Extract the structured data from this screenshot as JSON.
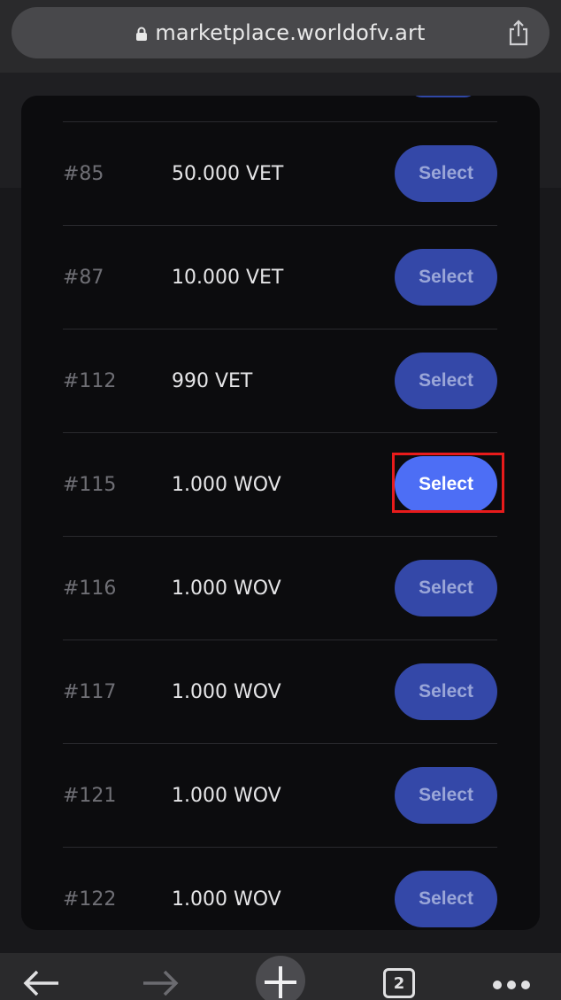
{
  "browser": {
    "url": "marketplace.worldofv.art",
    "tab_count": "2"
  },
  "listings": [
    {
      "number": "#85",
      "price": "50.000 VET",
      "button_label": "Select",
      "active": false
    },
    {
      "number": "#87",
      "price": "10.000 VET",
      "button_label": "Select",
      "active": false
    },
    {
      "number": "#112",
      "price": "990 VET",
      "button_label": "Select",
      "active": false
    },
    {
      "number": "#115",
      "price": "1.000 WOV",
      "button_label": "Select",
      "active": true
    },
    {
      "number": "#116",
      "price": "1.000 WOV",
      "button_label": "Select",
      "active": false
    },
    {
      "number": "#117",
      "price": "1.000 WOV",
      "button_label": "Select",
      "active": false
    },
    {
      "number": "#121",
      "price": "1.000 WOV",
      "button_label": "Select",
      "active": false
    },
    {
      "number": "#122",
      "price": "1.000 WOV",
      "button_label": "Select",
      "active": false
    }
  ],
  "colors": {
    "button": "#3448a8",
    "button_active": "#4d6ef5",
    "highlight": "#e81b1b"
  },
  "toolbar": {
    "icons": [
      "back-arrow-icon",
      "forward-arrow-icon",
      "new-tab-plus-icon",
      "tabs-icon",
      "more-icon"
    ]
  }
}
